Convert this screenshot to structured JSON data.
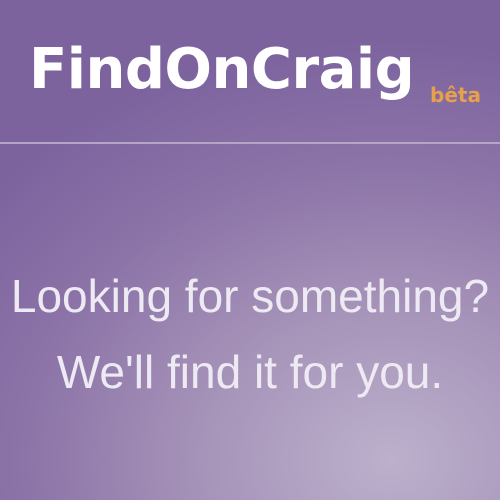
{
  "brand": {
    "name": "FindOnCraig",
    "badge": "bêta"
  },
  "colors": {
    "background": "#8c74a8",
    "logo": "#ffffff",
    "badge": "#e8a04a",
    "tagline": "#eeeaf3",
    "divider": "#b4a4c6"
  },
  "hero": {
    "line1": "Looking for something?",
    "line2": "We'll find it for you."
  }
}
